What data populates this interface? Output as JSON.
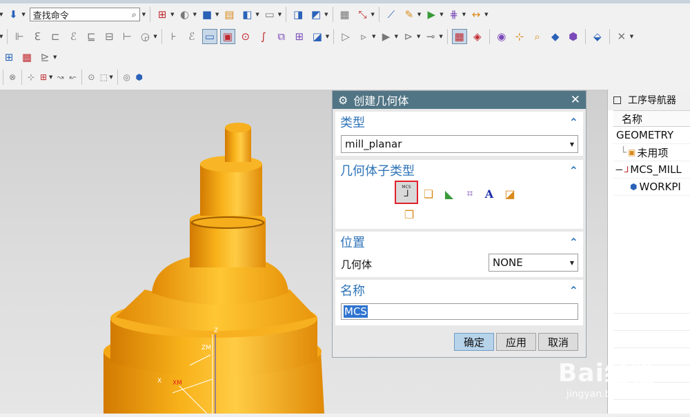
{
  "command_search": {
    "placeholder": "查找命令"
  },
  "dialog": {
    "title": "创建几何体",
    "type_section": {
      "header": "类型",
      "value": "mill_planar"
    },
    "subtype_section": {
      "header": "几何体子类型",
      "icons": [
        "mcs-icon",
        "workpiece-icon",
        "mill-area-icon",
        "mill-boundary-icon",
        "mill-text-icon",
        "mill-geom-icon",
        "mill-bnd-icon"
      ],
      "selected": "MCS",
      "mcs_label": "MCS"
    },
    "location_section": {
      "header": "位置",
      "geometry_label": "几何体",
      "geometry_value": "NONE"
    },
    "name_section": {
      "header": "名称",
      "value": "MCS"
    },
    "buttons": {
      "ok": "确定",
      "apply": "应用",
      "cancel": "取消"
    },
    "accent_color": "#517585"
  },
  "navigator": {
    "title": "工序导航器",
    "column_header": "名称",
    "rows": [
      {
        "label": "GEOMETRY",
        "indent": 0,
        "icon": ""
      },
      {
        "label": "未用项",
        "indent": 1,
        "icon": "folder-icon"
      },
      {
        "label": "MCS_MILL",
        "indent": 1,
        "icon": "mcs-icon"
      },
      {
        "label": "WORKPI",
        "indent": 2,
        "icon": "workpiece-icon"
      }
    ]
  },
  "viewport": {
    "axis_labels": {
      "z": "Z",
      "zm": "ZM",
      "x": "X",
      "xm": "XM"
    },
    "part_color": "#f2a20f"
  },
  "watermark": {
    "brand": "Bai经验",
    "url": "jingyan.baidu.com"
  }
}
